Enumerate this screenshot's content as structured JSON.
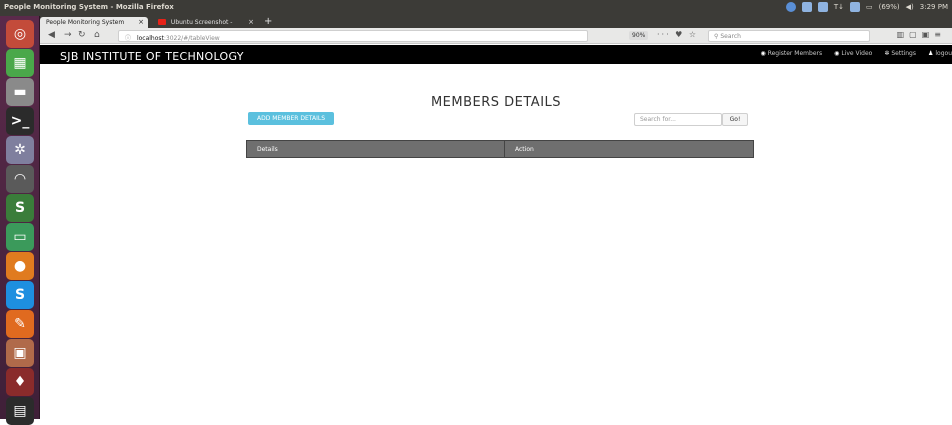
{
  "window": {
    "title": "People Monitoring System - Mozilla Firefox"
  },
  "system_tray": {
    "battery": "(69%)",
    "time": "3:29 PM"
  },
  "launcher": {
    "items": [
      {
        "icon": "ubuntu-dash-icon",
        "color": "#c34b3a"
      },
      {
        "icon": "spreadsheet-icon",
        "color": "#4aa84a"
      },
      {
        "icon": "files-icon",
        "color": "#8a8a8a"
      },
      {
        "icon": "terminal-icon",
        "color": "#2b2b2b"
      },
      {
        "icon": "settings-icon",
        "color": "#7f7f9e"
      },
      {
        "icon": "wifi-icon",
        "color": "#5a5a5a"
      },
      {
        "icon": "sublime-text-icon",
        "color": "#3a7d3a"
      },
      {
        "icon": "remote-desktop-icon",
        "color": "#3b9a5b"
      },
      {
        "icon": "firefox-icon",
        "color": "#e07b1f"
      },
      {
        "icon": "skype-icon",
        "color": "#1e8fe0"
      },
      {
        "icon": "pencil-app-icon",
        "color": "#e06a1f"
      },
      {
        "icon": "image-viewer-icon",
        "color": "#b06a4a"
      },
      {
        "icon": "wine-icon",
        "color": "#8a2b2b"
      },
      {
        "icon": "ide-icon",
        "color": "#2b2b2b"
      }
    ]
  },
  "browser": {
    "tabs": [
      {
        "label": "People Monitoring System",
        "close": "×"
      },
      {
        "label": "Ubuntu Screenshot -",
        "close": "×"
      }
    ],
    "new_tab": "+",
    "url_host": "localhost",
    "url_path": ":3022/#/tableView",
    "zoom": "90%",
    "search_placeholder": "Search"
  },
  "site": {
    "brand": "SJB INSTITUTE OF TECHNOLOGY",
    "nav": [
      {
        "icon": "camera-icon",
        "label": "Register Members"
      },
      {
        "icon": "video-icon",
        "label": "Live Video"
      },
      {
        "icon": "gear-icon",
        "label": "Settings"
      },
      {
        "icon": "user-icon",
        "label": "logou"
      }
    ]
  },
  "main": {
    "heading": "MEMBERS DETAILS",
    "add_button": "ADD MEMBER DETAILS",
    "search_placeholder": "Search for...",
    "go_button": "Go!",
    "table_headers": [
      "Details",
      "Action"
    ]
  }
}
